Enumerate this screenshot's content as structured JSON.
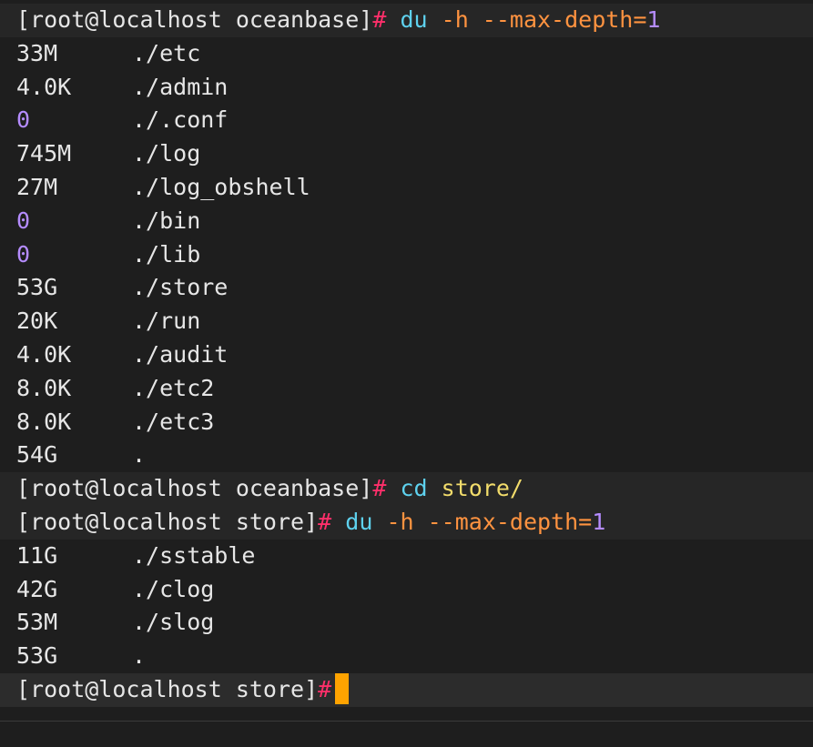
{
  "terminal": {
    "block1": {
      "prompt": "[root@localhost oceanbase]",
      "hash": "#",
      "cmd": "du",
      "opt": "-h --max-depth=",
      "num": "1",
      "rows": [
        {
          "size": "33M",
          "path": "./etc"
        },
        {
          "size": "4.0K",
          "path": "./admin"
        },
        {
          "size": "0",
          "path": "./.conf"
        },
        {
          "size": "745M",
          "path": "./log"
        },
        {
          "size": "27M",
          "path": "./log_obshell"
        },
        {
          "size": "0",
          "path": "./bin"
        },
        {
          "size": "0",
          "path": "./lib"
        },
        {
          "size": "53G",
          "path": "./store"
        },
        {
          "size": "20K",
          "path": "./run"
        },
        {
          "size": "4.0K",
          "path": "./audit"
        },
        {
          "size": "8.0K",
          "path": "./etc2"
        },
        {
          "size": "8.0K",
          "path": "./etc3"
        },
        {
          "size": "54G",
          "path": "."
        }
      ]
    },
    "block2": {
      "prompt": "[root@localhost oceanbase]",
      "hash": "#",
      "cmd": "cd",
      "arg": "store/"
    },
    "block3": {
      "prompt": "[root@localhost store]",
      "hash": "#",
      "cmd": "du",
      "opt": "-h --max-depth=",
      "num": "1",
      "rows": [
        {
          "size": "11G",
          "path": "./sstable"
        },
        {
          "size": "42G",
          "path": "./clog"
        },
        {
          "size": "53M",
          "path": "./slog"
        },
        {
          "size": "53G",
          "path": "."
        }
      ]
    },
    "block4": {
      "prompt": "[root@localhost store]",
      "hash": "#"
    },
    "colors": {
      "background": "#1e1e1e",
      "text": "#e6e6e6",
      "hash": "#ff2f6a",
      "command": "#5ed1ee",
      "option": "#ff9340",
      "number": "#b58cff",
      "argument": "#f2dc6b",
      "cursor": "#ffa300"
    },
    "icons": {
      "cursor": "block-cursor-icon"
    }
  }
}
